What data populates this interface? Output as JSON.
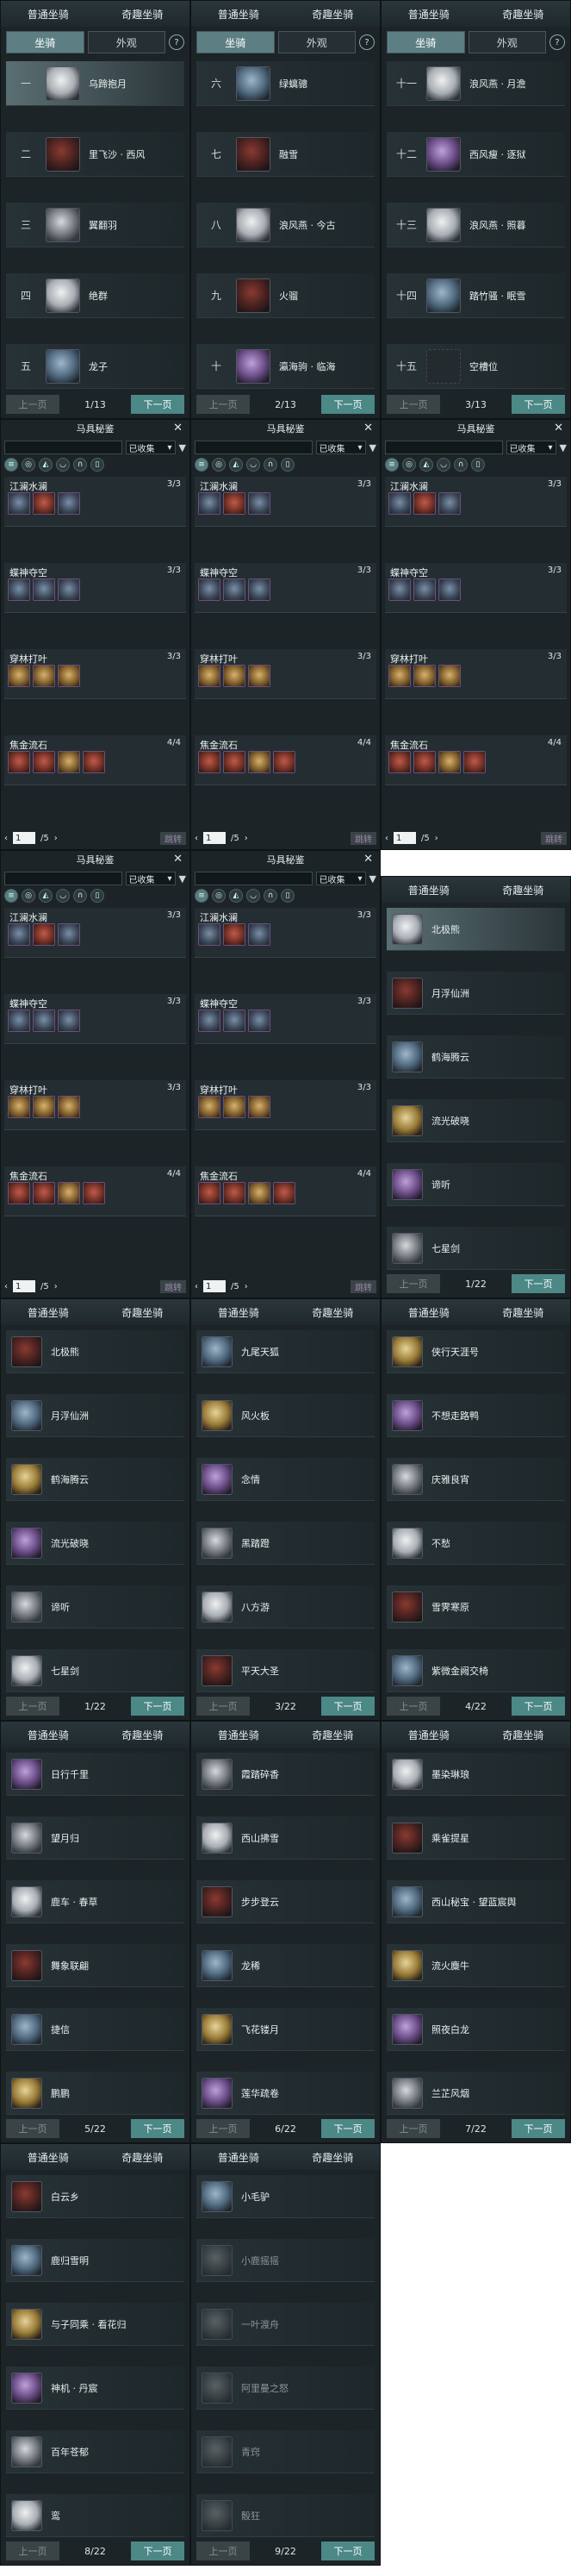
{
  "tabs": {
    "normal": "普通坐骑",
    "special": "奇趣坐骑"
  },
  "subtabs": {
    "mount": "坐骑",
    "look": "外观",
    "help": "?"
  },
  "pager": {
    "prev": "上一页",
    "next": "下一页"
  },
  "normal_pages": [
    {
      "page": "1/13",
      "rows": [
        {
          "num": "一",
          "name": "乌蹄抱月"
        },
        {
          "num": "二",
          "name": "里飞沙 · 西风"
        },
        {
          "num": "三",
          "name": "翼翻羽"
        },
        {
          "num": "四",
          "name": "绝群"
        },
        {
          "num": "五",
          "name": "龙子"
        }
      ]
    },
    {
      "page": "2/13",
      "rows": [
        {
          "num": "六",
          "name": "绿螭骢"
        },
        {
          "num": "七",
          "name": "融雪"
        },
        {
          "num": "八",
          "name": "浪风燕 · 今古"
        },
        {
          "num": "九",
          "name": "火骝"
        },
        {
          "num": "十",
          "name": "瀛海驹 · 临海"
        }
      ]
    },
    {
      "page": "3/13",
      "rows": [
        {
          "num": "十一",
          "name": "浪风燕 · 月澹"
        },
        {
          "num": "十二",
          "name": "西风瘦 · 逐狱"
        },
        {
          "num": "十三",
          "name": "浪风燕 · 照暮"
        },
        {
          "num": "十四",
          "name": "踏竹骚 · 眠雪"
        },
        {
          "num": "十五",
          "name": "空槽位"
        }
      ]
    }
  ],
  "mj": {
    "title": "马具秘鉴",
    "close": "✕",
    "search_placeholder": "",
    "filter": "已收集",
    "groups": [
      {
        "name": "江澜水澜",
        "count": "3/3",
        "slots": 3
      },
      {
        "name": "蝶神夺空",
        "count": "3/3",
        "slots": 3
      },
      {
        "name": "穿林打叶",
        "count": "3/3",
        "slots": 3
      },
      {
        "name": "焦金流石",
        "count": "4/4",
        "slots": 4
      }
    ],
    "page": "1",
    "total": "/5",
    "jump": "跳转"
  },
  "special_pages": [
    {
      "page": "1/22",
      "rows": [
        "北极熊",
        "月浮仙洲",
        "鹤海腾云",
        "流光破晓",
        "谛听",
        "七星剑"
      ]
    },
    {
      "page": "1/22",
      "rows": [
        "北极熊",
        "月浮仙洲",
        "鹤海腾云",
        "流光破晓",
        "谛听",
        "七星剑"
      ]
    },
    {
      "page": "3/22",
      "rows": [
        "九尾天狐",
        "风火板",
        "念情",
        "黑踏蹬",
        "八方游",
        "平天大圣"
      ]
    },
    {
      "page": "4/22",
      "rows": [
        "侠行天涯号",
        "不想走路鸭",
        "庆雅良宵",
        "不愁",
        "雪霁寒原",
        "紫微金阙交椅"
      ]
    },
    {
      "page": "5/22",
      "rows": [
        "日行千里",
        "望月归",
        "鹿车 · 春草",
        "舞象联翩",
        "捷信",
        "鹏鹏"
      ]
    },
    {
      "page": "6/22",
      "rows": [
        "霞踏碎香",
        "西山拂雪",
        "步步登云",
        "龙稀",
        "飞花镂月",
        "莲华疏卷"
      ]
    },
    {
      "page": "7/22",
      "rows": [
        "墨染琳琅",
        "乘雀提星",
        "西山秘宝 · 望蓝宸舆",
        "流火麋牛",
        "照夜白龙",
        "兰芷风烟"
      ]
    },
    {
      "page": "8/22",
      "rows": [
        "白云乡",
        "鹿归雪明",
        "与子同乘 · 看花归",
        "神机 · 丹宸",
        "百年苍郁",
        "鸾"
      ]
    },
    {
      "page": "9/22",
      "rows": [
        "小毛驴",
        "小鹿摇摇",
        "一叶渡舟",
        "阿里曼之怒",
        "青窍",
        "骰狂"
      ]
    }
  ]
}
